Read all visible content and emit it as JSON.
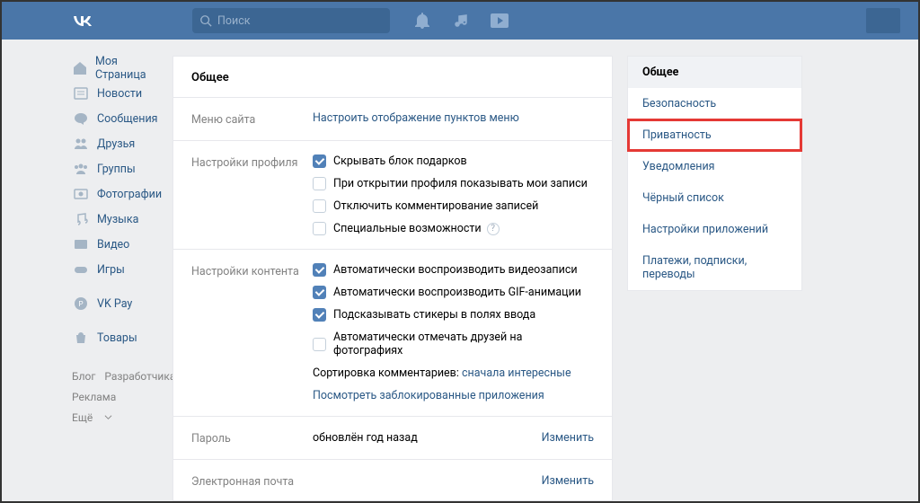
{
  "header": {
    "logo": "VK",
    "search_placeholder": "Поиск"
  },
  "left_nav": [
    {
      "label": "Моя Страница",
      "icon": "home"
    },
    {
      "label": "Новости",
      "icon": "news"
    },
    {
      "label": "Сообщения",
      "icon": "messages"
    },
    {
      "label": "Друзья",
      "icon": "friends"
    },
    {
      "label": "Группы",
      "icon": "groups"
    },
    {
      "label": "Фотографии",
      "icon": "photos"
    },
    {
      "label": "Музыка",
      "icon": "music"
    },
    {
      "label": "Видео",
      "icon": "video"
    },
    {
      "label": "Игры",
      "icon": "games"
    }
  ],
  "left_nav_extra": [
    {
      "label": "VK Pay",
      "icon": "pay"
    },
    {
      "label": "Товары",
      "icon": "market"
    }
  ],
  "footer": {
    "blog": "Блог",
    "devs": "Разработчикам",
    "ads": "Реклама",
    "more": "Ещё"
  },
  "settings": {
    "title": "Общее",
    "site_menu": {
      "label": "Меню сайта",
      "link": "Настроить отображение пунктов меню"
    },
    "profile": {
      "label": "Настройки профиля",
      "hide_gifts": "Скрывать блок подарков",
      "show_posts": "При открытии профиля показывать мои записи",
      "disable_comments": "Отключить комментирование записей",
      "accessibility": "Специальные возможности"
    },
    "content": {
      "label": "Настройки контента",
      "autoplay_video": "Автоматически воспроизводить видеозаписи",
      "autoplay_gif": "Автоматически воспроизводить GIF-анимации",
      "suggest_stickers": "Подсказывать стикеры в полях ввода",
      "autotag_friends": "Автоматически отмечать друзей на фотографиях",
      "comment_sort_label": "Сортировка комментариев:",
      "comment_sort_value": "сначала интересные",
      "blocked_apps": "Посмотреть заблокированные приложения"
    },
    "password": {
      "label": "Пароль",
      "status": "обновлён год назад",
      "change": "Изменить"
    },
    "email": {
      "label": "Электронная почта",
      "change": "Изменить"
    }
  },
  "right_nav": [
    {
      "label": "Общее",
      "active": true
    },
    {
      "label": "Безопасность"
    },
    {
      "label": "Приватность",
      "highlighted": true
    },
    {
      "label": "Уведомления"
    },
    {
      "label": "Чёрный список"
    },
    {
      "label": "Настройки приложений"
    },
    {
      "label": "Платежи, подписки, переводы"
    }
  ]
}
